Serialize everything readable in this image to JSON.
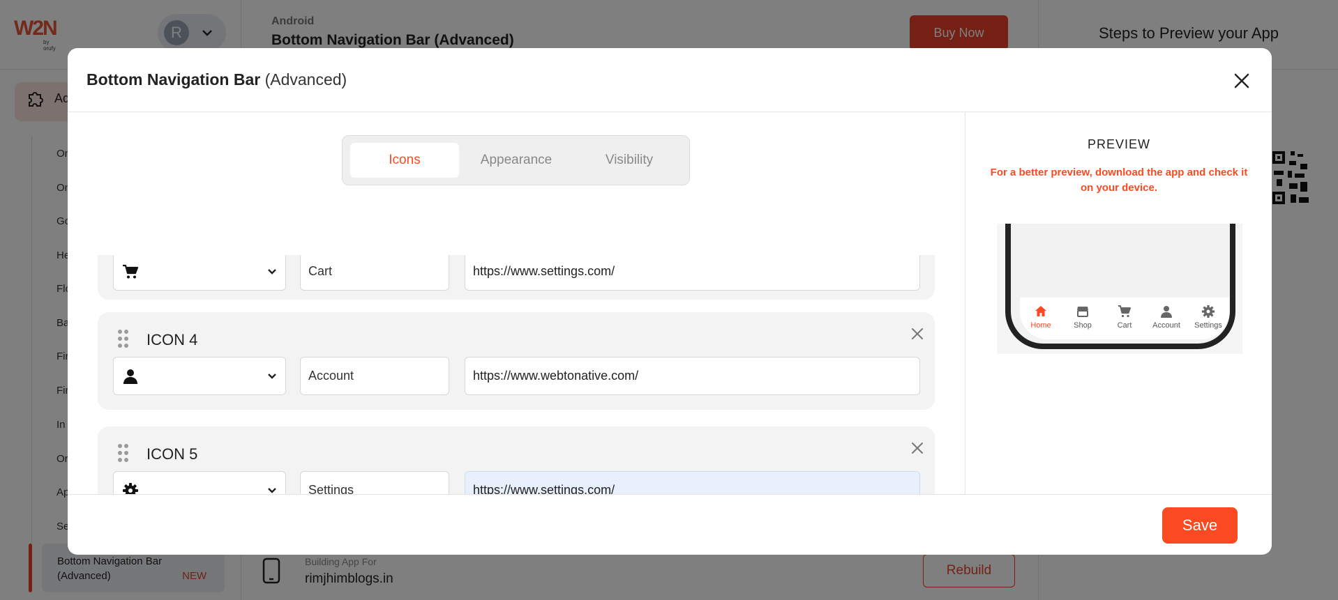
{
  "background": {
    "logo_text": "W2N",
    "logo_sub": "by orufy",
    "user_initial": "R",
    "platform": "Android",
    "page_title": "Bottom Navigation Bar (Advanced)",
    "buy_now_label": "Buy Now",
    "steps_title": "Steps to Preview your App",
    "sidebar_active_label": "Ad",
    "sidebar_items": [
      "On",
      "On",
      "Go",
      "He",
      "Flo",
      "Ba",
      "Fir",
      "Fir",
      "In",
      "Or",
      "Ap",
      "Se"
    ],
    "sidebar_selected_label": "Bottom Navigation Bar (Advanced)",
    "sidebar_selected_badge": "NEW",
    "building_label": "Building App For",
    "building_domain": "rimjhimblogs.in",
    "rebuild_label": "Rebuild"
  },
  "modal": {
    "title_main": "Bottom Navigation Bar",
    "title_suffix": "(Advanced)",
    "tabs": [
      {
        "label": "Icons",
        "active": true
      },
      {
        "label": "Appearance",
        "active": false
      },
      {
        "label": "Visibility",
        "active": false
      }
    ],
    "icons": [
      {
        "heading": "",
        "icon": "cart-icon",
        "label": "Cart",
        "url": "https://www.settings.com/"
      },
      {
        "heading": "ICON 4",
        "icon": "user-icon",
        "label": "Account",
        "url": "https://www.webtonative.com/"
      },
      {
        "heading": "ICON 5",
        "icon": "gear-icon",
        "label": "Settings",
        "url": "https://www.settings.com/"
      }
    ],
    "save_label": "Save"
  },
  "preview": {
    "title": "PREVIEW",
    "note": "For a better preview, download the app and check it on your device.",
    "nav_items": [
      {
        "label": "Home",
        "icon": "home-icon",
        "active": true
      },
      {
        "label": "Shop",
        "icon": "store-icon",
        "active": false
      },
      {
        "label": "Cart",
        "icon": "cart-icon",
        "active": false
      },
      {
        "label": "Account",
        "icon": "user-icon",
        "active": false
      },
      {
        "label": "Settings",
        "icon": "gear-icon",
        "active": false
      }
    ]
  },
  "colors": {
    "accent": "#fa4a22",
    "overlay": "rgba(0,0,0,0.5)",
    "card_bg": "#f3f3f3",
    "focus_bg": "#e8f0fe"
  }
}
